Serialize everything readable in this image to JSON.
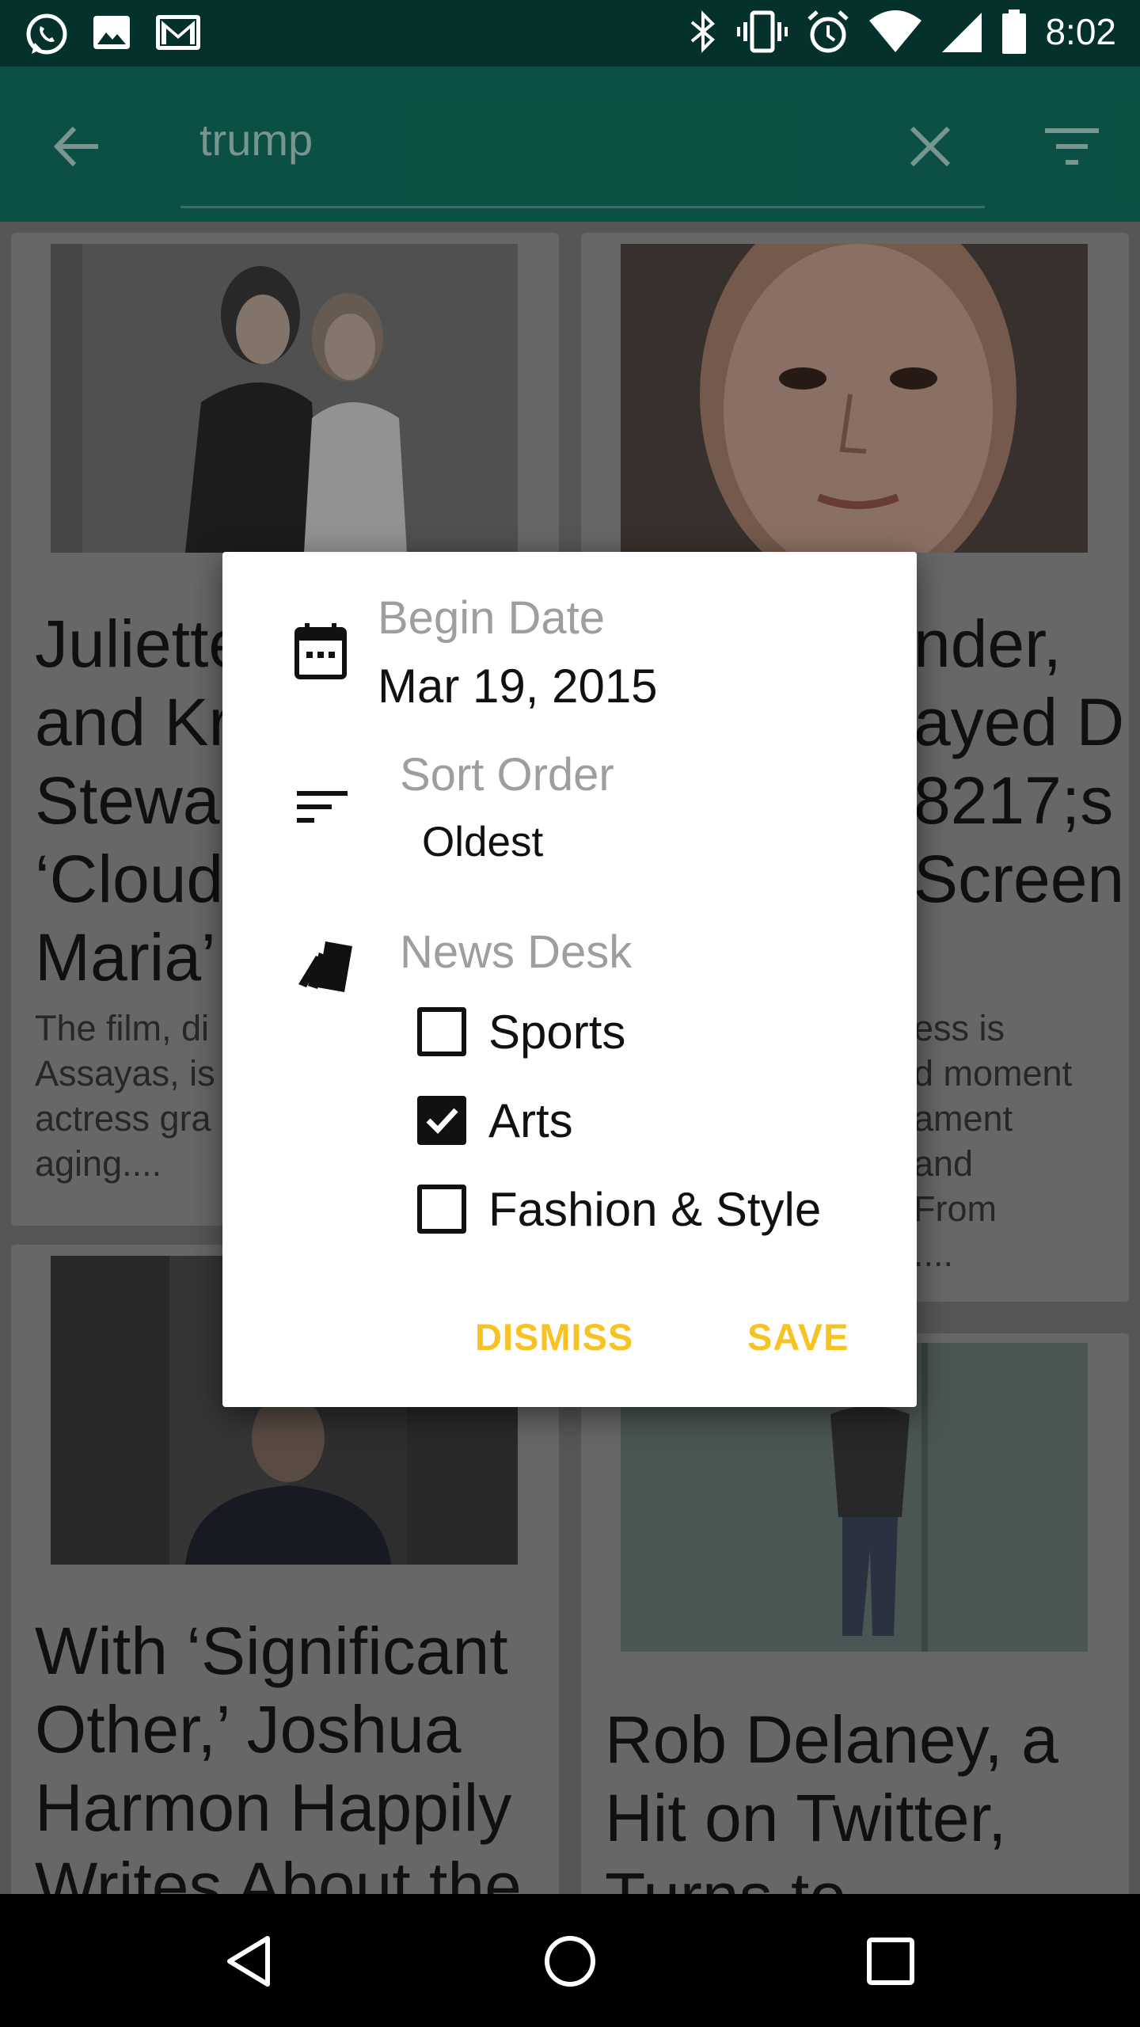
{
  "status_bar": {
    "time": "8:02",
    "left_icons": [
      "whatsapp-icon",
      "image-icon",
      "gmail-icon"
    ],
    "right_icons": [
      "bluetooth-icon",
      "vibrate-icon",
      "alarm-icon",
      "wifi-icon",
      "signal-icon",
      "battery-icon"
    ]
  },
  "toolbar": {
    "query": "trump",
    "bg_color": "#0d5448"
  },
  "articles": [
    {
      "title_lines": [
        "Juliette",
        "and Kr",
        "Stewar",
        "‘Cloud",
        "Maria’"
      ],
      "abstract_lines": [
        "The film, di",
        "Assayas, is",
        "actress gra",
        "aging...."
      ]
    },
    {
      "title_lines": [
        "nder,",
        "ayed D",
        "8217;s",
        "Screen"
      ],
      "abstract_lines": [
        "ess is",
        "d moment",
        "ament",
        "and",
        "From",
        "...."
      ]
    },
    {
      "title_lines": [
        "With ‘Significant",
        "Other,’ Joshua",
        "Harmon Happily",
        "Writes About the"
      ],
      "abstract_lines": []
    },
    {
      "title_lines": [
        "Rob Delaney, a",
        "Hit on Twitter,",
        "Turns to"
      ],
      "abstract_lines": []
    }
  ],
  "dialog": {
    "begin_date_label": "Begin Date",
    "begin_date_value": "Mar 19, 2015",
    "sort_order_label": "Sort Order",
    "sort_order_value": "Oldest",
    "news_desk_label": "News Desk",
    "news_desk_options": [
      {
        "label": "Sports",
        "checked": false
      },
      {
        "label": "Arts",
        "checked": true
      },
      {
        "label": "Fashion & Style",
        "checked": false
      }
    ],
    "dismiss_label": "DISMISS",
    "save_label": "SAVE",
    "accent_color": "#f7c224"
  },
  "nav_bar": {
    "buttons": [
      "back-triangle-icon",
      "home-circle-icon",
      "recents-square-icon"
    ]
  }
}
